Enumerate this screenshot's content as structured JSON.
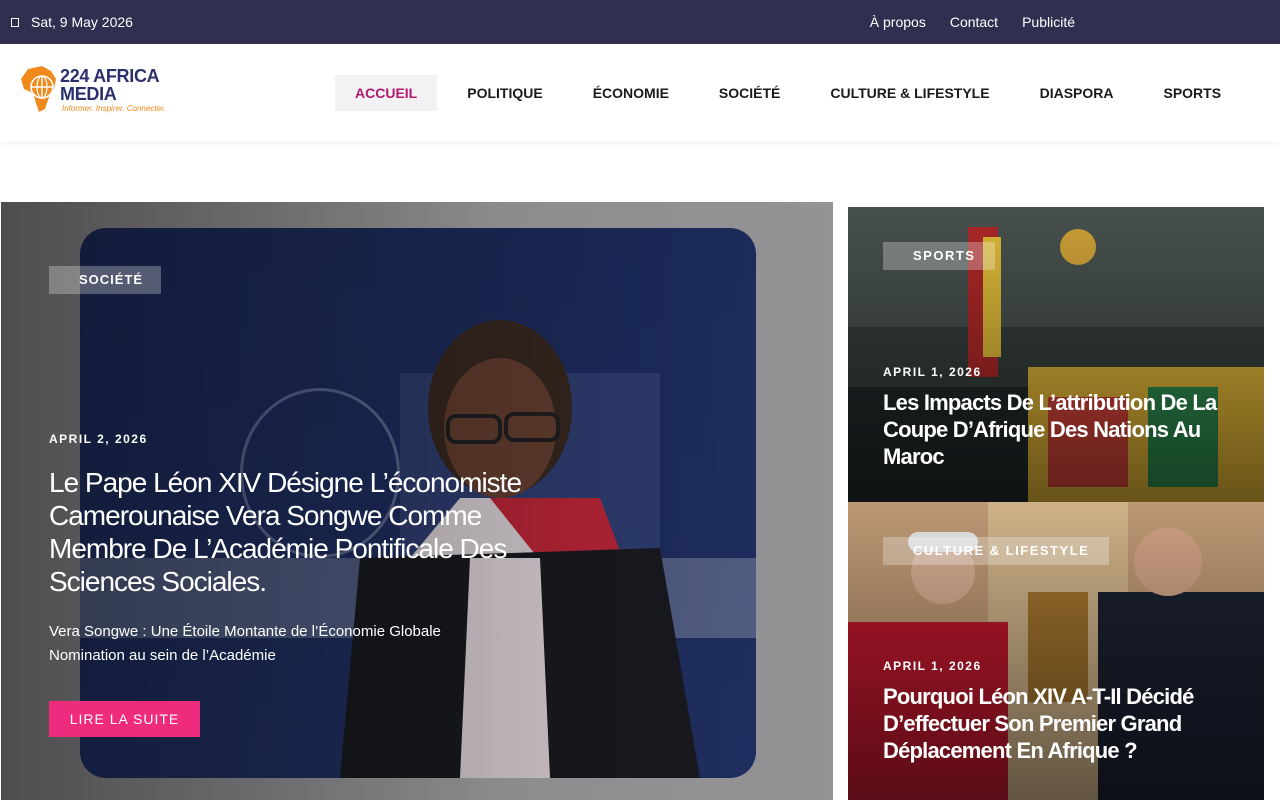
{
  "topbar": {
    "date": "Sat, 9 May 2026",
    "links": [
      "À propos",
      "Contact",
      "Publicité"
    ]
  },
  "brand": {
    "name_line1": "224 AFRICA",
    "name_line2": "MEDIA",
    "tagline": "Informer. Inspirer. Connecter.",
    "colors": {
      "navy": "#2b2f6b",
      "orange": "#f08a1c"
    }
  },
  "nav": {
    "items": [
      "ACCUEIL",
      "POLITIQUE",
      "ÉCONOMIE",
      "SOCIÉTÉ",
      "CULTURE & LIFESTYLE",
      "DIASPORA",
      "SPORTS"
    ],
    "active": "ACCUEIL",
    "active_color": "#b0196e"
  },
  "hero": {
    "category": "SOCIÉTÉ",
    "date": "APRIL 2, 2026",
    "title": "Le Pape Léon XIV Désigne L’économiste Camerounaise Vera Songwe Comme Membre De L’Académie Pontificale Des Sciences Sociales.",
    "excerpt_line1": "Vera Songwe : Une Étoile Montante de l’Économie Globale",
    "excerpt_line2": "Nomination au sein de l’Académie",
    "button": "LIRE LA SUITE",
    "button_color": "#ee2b7d"
  },
  "side_articles": [
    {
      "category": "SPORTS",
      "date": "APRIL 1, 2026",
      "title": "Les Impacts De L’attribution De La Coupe D’Afrique Des Nations Au Maroc"
    },
    {
      "category": "CULTURE & LIFESTYLE",
      "date": "APRIL 1, 2026",
      "title": "Pourquoi Léon XIV A-T-Il Décidé D’effectuer Son Premier Grand Déplacement En Afrique ?"
    }
  ]
}
